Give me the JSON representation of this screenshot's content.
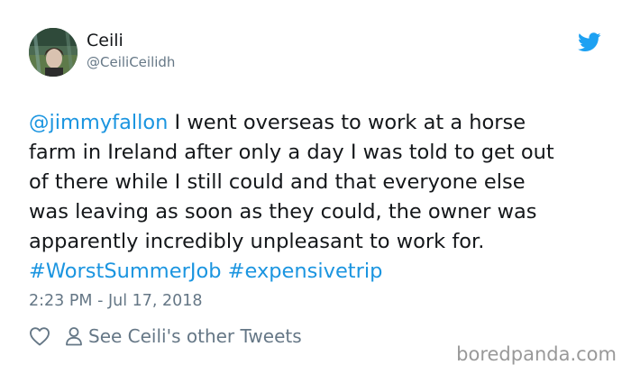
{
  "user": {
    "name": "Ceili",
    "handle": "@CeiliCeilidh"
  },
  "tweet": {
    "mention": "@jimmyfallon",
    "line1_rest": " I went overseas to work at a horse",
    "line2": "farm in Ireland after only a day I was told to get out",
    "line3": "of there while I still could and that everyone else",
    "line4": "was leaving as soon as they could, the owner was",
    "line5": "apparently incredibly unpleasant to work for.",
    "hashtag1": "#WorstSummerJob",
    "hashtag2": "#expensivetrip",
    "timestamp": "2:23 PM - Jul 17, 2018"
  },
  "actions": {
    "like_icon": "heart-icon",
    "profile_icon": "person-icon",
    "see_other_label": "See Ceili's other Tweets"
  },
  "branding": {
    "twitter_icon": "twitter-bird-icon",
    "watermark": "boredpanda.com"
  },
  "colors": {
    "link": "#1b95e0",
    "text": "#14171a",
    "muted": "#657786",
    "watermark": "#999999"
  }
}
